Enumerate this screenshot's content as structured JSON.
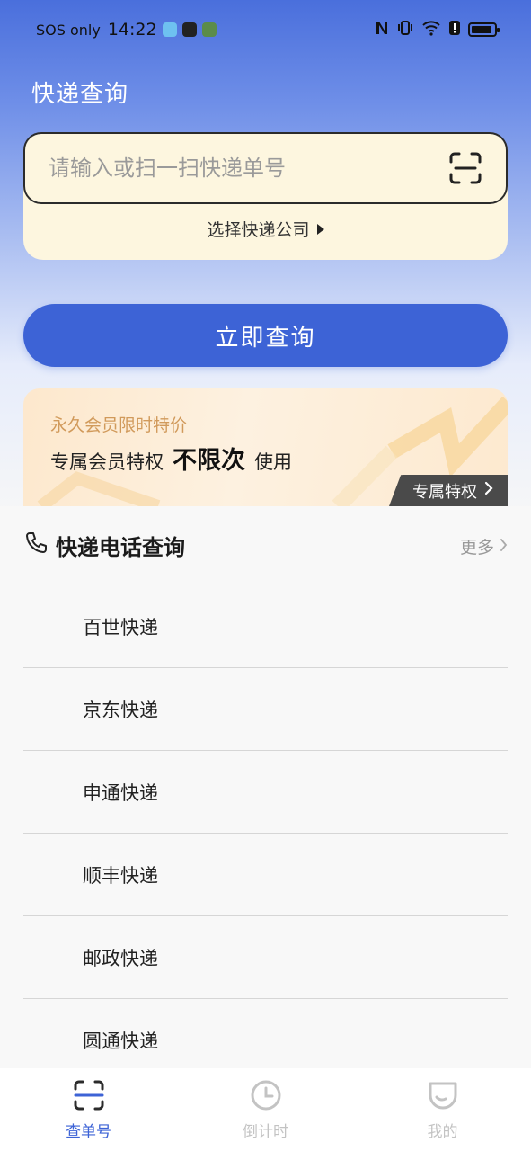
{
  "status_bar": {
    "carrier": "SOS only",
    "time": "14:22"
  },
  "page": {
    "title": "快递查询"
  },
  "search": {
    "placeholder": "请输入或扫一扫快递单号",
    "value": "",
    "choose_company": "选择快递公司"
  },
  "query_button": "立即查询",
  "promo": {
    "line1": "永久会员限时特价",
    "line2_prefix": "专属会员特权",
    "line2_bold": "不限次",
    "line2_suffix": "使用",
    "tag": "专属特权"
  },
  "phone_section": {
    "title": "快递电话查询",
    "more": "更多",
    "items": [
      {
        "label": "百世快递"
      },
      {
        "label": "京东快递"
      },
      {
        "label": "申通快递"
      },
      {
        "label": "顺丰快递"
      },
      {
        "label": "邮政快递"
      },
      {
        "label": "圆通快递"
      }
    ]
  },
  "bottom_nav": {
    "items": [
      {
        "label": "查单号",
        "icon": "scan-icon",
        "active": true
      },
      {
        "label": "倒计时",
        "icon": "clock-icon",
        "active": false
      },
      {
        "label": "我的",
        "icon": "profile-icon",
        "active": false
      }
    ]
  },
  "colors": {
    "primary": "#3d63d6",
    "card_bg": "#fdf6df",
    "promo_text": "#d19a5b",
    "inactive": "#c3c3c3"
  }
}
